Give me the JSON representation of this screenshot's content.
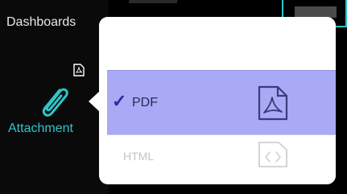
{
  "sidebar": {
    "dashboards_label": "Dashboards",
    "attachment_label": "Attachment",
    "attachment_icon": "paperclip-icon",
    "attachment_badge_icon": "pdf-file-icon"
  },
  "popover": {
    "options": [
      {
        "label": "PDF",
        "selected": true,
        "icon": "pdf-file-icon"
      },
      {
        "label": "HTML",
        "selected": false,
        "icon": "html-file-icon"
      }
    ],
    "check_glyph": "✓"
  },
  "colors": {
    "accent": "#2ec5c9",
    "selection": "#a9a9f5",
    "check": "#2a2aa0"
  }
}
